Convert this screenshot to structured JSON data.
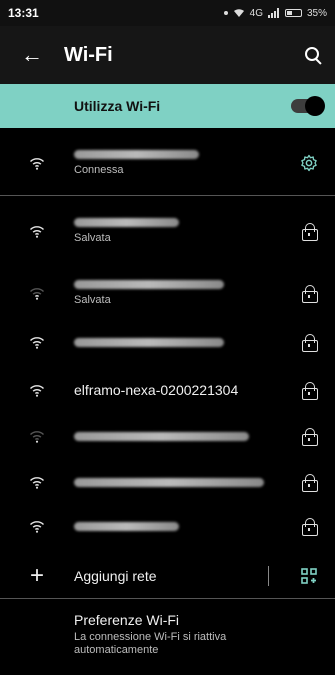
{
  "status_bar": {
    "time": "13:31",
    "network_type": "4G",
    "battery": "35%",
    "battery_level": 0.35
  },
  "app_bar": {
    "title": "Wi-Fi",
    "back_icon": "back-arrow-icon",
    "search_icon": "search-icon"
  },
  "wifi_toggle": {
    "label": "Utilizza Wi-Fi",
    "enabled": true
  },
  "networks": [
    {
      "name": "",
      "name_redacted": true,
      "status": "Connessa",
      "signal_level": 3,
      "trailing_icon": "gear-icon"
    },
    {
      "name": "",
      "name_redacted": true,
      "status": "Salvata",
      "signal_level": 3,
      "trailing_icon": "lock-icon"
    },
    {
      "name": "",
      "name_redacted": true,
      "status": "Salvata",
      "signal_level": 1,
      "trailing_icon": "lock-icon"
    },
    {
      "name": "",
      "name_redacted": true,
      "status": "",
      "signal_level": 3,
      "trailing_icon": "lock-icon"
    },
    {
      "name": "elframo-nexa-0200221304",
      "name_redacted": false,
      "status": "",
      "signal_level": 3,
      "trailing_icon": "lock-icon"
    },
    {
      "name": "",
      "name_redacted": true,
      "status": "",
      "signal_level": 0,
      "trailing_icon": "lock-icon"
    },
    {
      "name": "",
      "name_redacted": true,
      "status": "",
      "signal_level": 3,
      "trailing_icon": "lock-icon"
    },
    {
      "name": "",
      "name_redacted": true,
      "status": "",
      "signal_level": 3,
      "trailing_icon": "lock-icon"
    }
  ],
  "add_network": {
    "label": "Aggiungi rete",
    "icon": "plus-icon",
    "qr_icon": "qr-code-scan-icon"
  },
  "preferences": {
    "title": "Preferenze Wi-Fi",
    "subtitle": "La connessione Wi-Fi si riattiva automaticamente"
  },
  "colors": {
    "accent": "#7fd1c4",
    "background": "#000000"
  }
}
